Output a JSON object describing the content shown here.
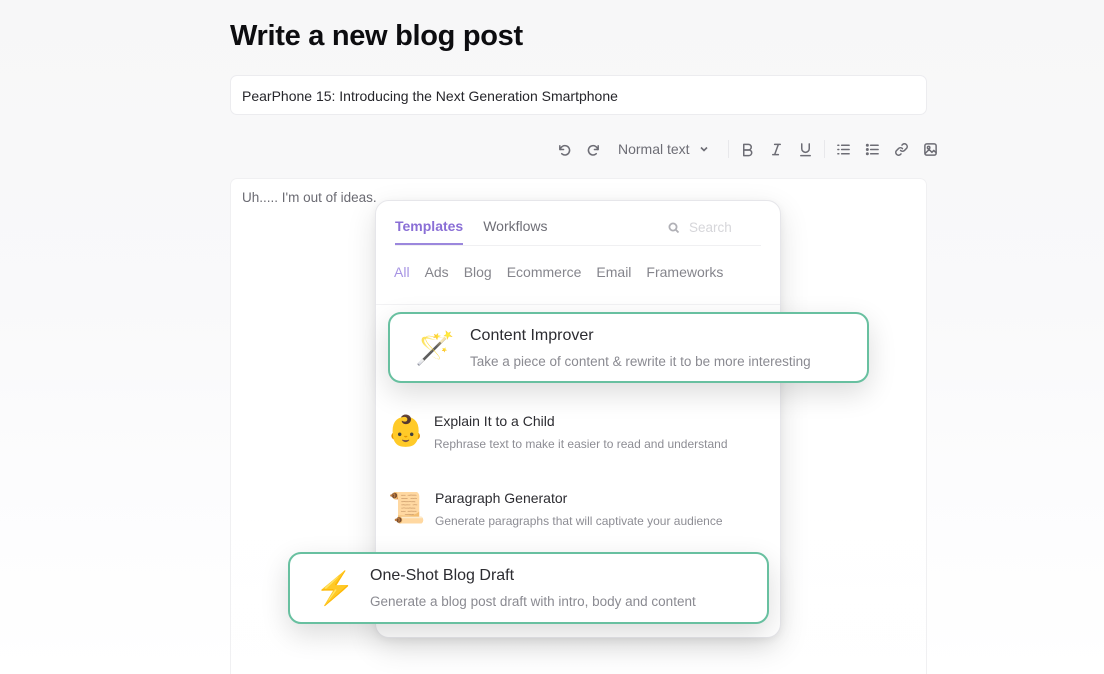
{
  "page": {
    "title": "Write a new blog post"
  },
  "title_field": {
    "value": "PearPhone 15: Introducing the Next Generation Smartphone"
  },
  "toolbar": {
    "undo_icon": "undo-icon",
    "redo_icon": "redo-icon",
    "text_style": "Normal text",
    "buttons": [
      {
        "name": "bold",
        "icon": "B"
      },
      {
        "name": "italic",
        "icon": "I"
      },
      {
        "name": "underline",
        "icon": "U"
      },
      {
        "name": "ordered-list",
        "icon": "list-icon"
      },
      {
        "name": "bullet-list",
        "icon": "list-icon"
      },
      {
        "name": "link",
        "icon": "link-icon"
      },
      {
        "name": "image",
        "icon": "image-icon"
      }
    ]
  },
  "editor": {
    "content": "Uh..... I'm out of ideas."
  },
  "panel": {
    "tabs": [
      {
        "label": "Templates",
        "active": true
      },
      {
        "label": "Workflows",
        "active": false
      }
    ],
    "search_placeholder": "Search",
    "categories": [
      {
        "label": "All",
        "active": true
      },
      {
        "label": "Ads",
        "active": false
      },
      {
        "label": "Blog",
        "active": false
      },
      {
        "label": "Ecommerce",
        "active": false
      },
      {
        "label": "Email",
        "active": false
      },
      {
        "label": "Frameworks",
        "active": false
      }
    ],
    "templates": [
      {
        "name": "Content Improver",
        "description": "Take a piece of content & rewrite it to be more interesting",
        "icon": "🪄",
        "highlighted": true
      },
      {
        "name": "Explain It to a Child",
        "description": "Rephrase text to make it easier to read and understand",
        "icon": "👶",
        "highlighted": false
      },
      {
        "name": "Paragraph Generator",
        "description": "Generate paragraphs that will captivate your audience",
        "icon": "📜",
        "highlighted": false
      },
      {
        "name": "One-Shot Blog Draft",
        "description": "Generate a blog post draft with intro, body and content",
        "icon": "⚡",
        "highlighted": true
      }
    ]
  },
  "colors": {
    "accent_purple": "#8a6fd6",
    "highlight_green": "#68c0a0"
  }
}
